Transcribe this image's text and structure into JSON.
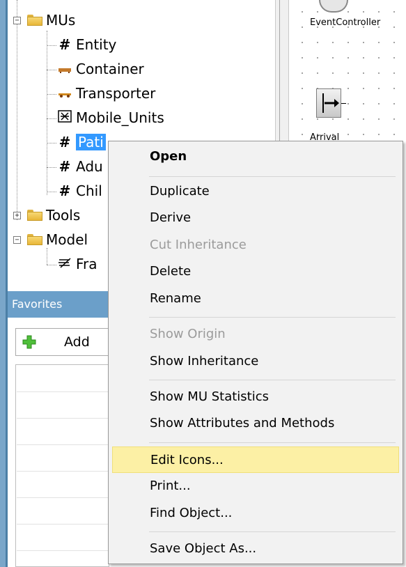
{
  "tree": {
    "items": [
      {
        "label": "MUs",
        "icon": "folder-icon"
      },
      {
        "label": "Entity",
        "icon": "entity-hash-icon"
      },
      {
        "label": "Container",
        "icon": "container-icon"
      },
      {
        "label": "Transporter",
        "icon": "transporter-icon"
      },
      {
        "label": "Mobile_Units",
        "icon": "mobile-units-icon"
      },
      {
        "label": "Patient",
        "icon": "entity-hash-icon",
        "selected": true
      },
      {
        "label": "Adult",
        "icon": "entity-hash-icon"
      },
      {
        "label": "Child",
        "icon": "entity-hash-icon"
      },
      {
        "label": "Tools",
        "icon": "folder-icon"
      },
      {
        "label": "Models",
        "icon": "folder-icon"
      },
      {
        "label": "Frame",
        "icon": "frame-icon"
      }
    ],
    "visible_texts": [
      "MUs",
      "Entity",
      "Container",
      "Transporter",
      "Mobile_Units",
      "Pati",
      "Adu",
      "Chil",
      "Tools",
      "Model",
      "Fra"
    ]
  },
  "favorites": {
    "title": "Favorites",
    "add_label": "Add"
  },
  "canvas": {
    "objects": [
      {
        "label": "EventController",
        "icon": "event-controller-icon"
      },
      {
        "label": "Arrival",
        "icon": "source-arrival-icon"
      }
    ]
  },
  "context_menu": {
    "items": [
      {
        "label": "Open",
        "bold": true
      },
      {
        "label": "Duplicate"
      },
      {
        "label": "Derive"
      },
      {
        "label": "Cut Inheritance",
        "disabled": true
      },
      {
        "label": "Delete"
      },
      {
        "label": "Rename"
      },
      {
        "label": "Show Origin",
        "disabled": true
      },
      {
        "label": "Show Inheritance"
      },
      {
        "label": "Show MU Statistics"
      },
      {
        "label": "Show Attributes and Methods"
      },
      {
        "label": "Edit Icons...",
        "highlighted": true
      },
      {
        "label": "Print..."
      },
      {
        "label": "Find Object..."
      },
      {
        "label": "Save Object As..."
      }
    ]
  },
  "colors": {
    "selection": "#3399ff",
    "menu_highlight": "#fcf0a5",
    "panel_header": "#6b9fc9",
    "disabled_text": "#9b9b9b"
  }
}
